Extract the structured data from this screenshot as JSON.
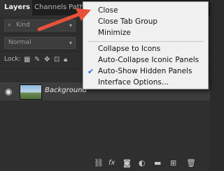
{
  "tabs": [
    {
      "label": "Layers",
      "active": true
    },
    {
      "label": "Channels",
      "active": false
    },
    {
      "label": "Path",
      "active": false
    }
  ],
  "filter": {
    "kind_placeholder": "Kind"
  },
  "blend_mode": {
    "value": "Normal"
  },
  "lock": {
    "label": "Lock:"
  },
  "layer": {
    "name": "Background"
  },
  "menu": {
    "items": [
      {
        "label": "Close",
        "checked": false
      },
      {
        "label": "Close Tab Group",
        "checked": false
      },
      {
        "label": "Minimize",
        "checked": false
      },
      {
        "label": "Collapse to Icons",
        "checked": false
      },
      {
        "label": "Auto-Collapse Iconic Panels",
        "checked": false
      },
      {
        "label": "Auto-Show Hidden Panels",
        "checked": true
      },
      {
        "label": "Interface Options...",
        "checked": false
      }
    ]
  },
  "bottom_icons": {
    "fx": "fx"
  },
  "colors": {
    "arrow": "#e8503a",
    "check": "#1e73d8",
    "menu_bg": "#f0f0f0",
    "panel_bg": "#2f2f2f"
  }
}
